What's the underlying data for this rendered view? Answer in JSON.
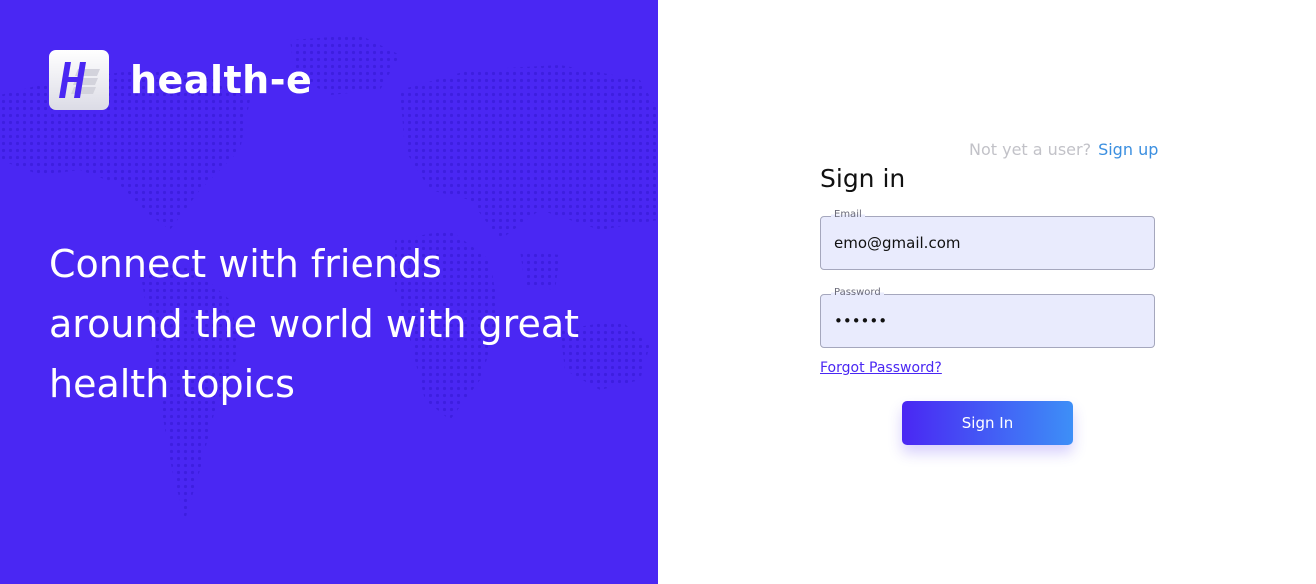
{
  "brand": {
    "name": "health-e",
    "logo_icon": "health-e-logo-icon"
  },
  "hero": {
    "lines": [
      "Connect with friends",
      "around the world with great",
      "health topics"
    ]
  },
  "auth": {
    "signup_prompt": "Not yet a user?",
    "signup_link": "Sign up",
    "title": "Sign in",
    "email_label": "Email",
    "email_value": "emo@gmail.com",
    "password_label": "Password",
    "password_value": "••••••",
    "forgot_link": "Forgot Password?",
    "submit_label": "Sign In"
  },
  "colors": {
    "brand_primary": "#4a27f3",
    "accent_blue": "#3b8fe0",
    "input_bg": "#e9ebfd"
  }
}
